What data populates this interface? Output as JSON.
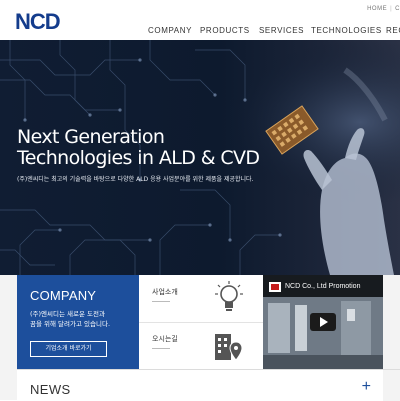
{
  "header": {
    "logo": "NCD",
    "utility": [
      "HOME",
      "C"
    ],
    "nav": [
      "COMPANY",
      "PRODUCTS",
      "SERVICES",
      "TECHNOLOGIES",
      "REC"
    ]
  },
  "hero": {
    "title_line1": "Next Generation",
    "title_line2": "Technologies in ALD & CVD",
    "subtitle": "(주)엔씨디는 최고의 기술력을 바탕으로 다양한 ALD 응용 사업분야를 위한 제품을 제공합니다."
  },
  "company_box": {
    "title": "COMPANY",
    "desc_line1": "(주)엔씨디는 새로운 도전과",
    "desc_line2": "꿈을 위해 달려가고 있습니다.",
    "button": "기업소개 바로가기"
  },
  "quick_links": [
    {
      "label": "사업소개",
      "icon": "lightbulb-icon"
    },
    {
      "label": "오시는길",
      "icon": "building-location-icon"
    }
  ],
  "video": {
    "title": "NCD Co., Ltd Promotion"
  },
  "news": {
    "title": "NEWS",
    "more": "+"
  },
  "colors": {
    "brand": "#143c8c",
    "company_bg": "#1d4f9c",
    "hero_bg": "#0c1627"
  }
}
